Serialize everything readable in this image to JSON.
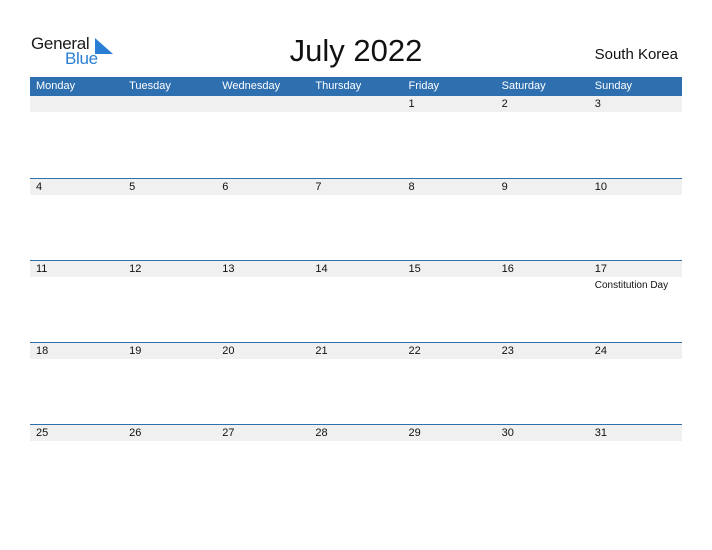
{
  "logo": {
    "word1": "General",
    "word2": "Blue",
    "accent": "#2a7fd4"
  },
  "title": "July 2022",
  "country": "South Korea",
  "colors": {
    "header_bg": "#2e6fb0",
    "strip_bg": "#f0f0f0"
  },
  "weekdays": [
    "Monday",
    "Tuesday",
    "Wednesday",
    "Thursday",
    "Friday",
    "Saturday",
    "Sunday"
  ],
  "weeks": [
    [
      {
        "day": ""
      },
      {
        "day": ""
      },
      {
        "day": ""
      },
      {
        "day": ""
      },
      {
        "day": "1"
      },
      {
        "day": "2"
      },
      {
        "day": "3"
      }
    ],
    [
      {
        "day": "4"
      },
      {
        "day": "5"
      },
      {
        "day": "6"
      },
      {
        "day": "7"
      },
      {
        "day": "8"
      },
      {
        "day": "9"
      },
      {
        "day": "10"
      }
    ],
    [
      {
        "day": "11"
      },
      {
        "day": "12"
      },
      {
        "day": "13"
      },
      {
        "day": "14"
      },
      {
        "day": "15"
      },
      {
        "day": "16"
      },
      {
        "day": "17",
        "event": "Constitution Day"
      }
    ],
    [
      {
        "day": "18"
      },
      {
        "day": "19"
      },
      {
        "day": "20"
      },
      {
        "day": "21"
      },
      {
        "day": "22"
      },
      {
        "day": "23"
      },
      {
        "day": "24"
      }
    ],
    [
      {
        "day": "25"
      },
      {
        "day": "26"
      },
      {
        "day": "27"
      },
      {
        "day": "28"
      },
      {
        "day": "29"
      },
      {
        "day": "30"
      },
      {
        "day": "31"
      }
    ]
  ]
}
